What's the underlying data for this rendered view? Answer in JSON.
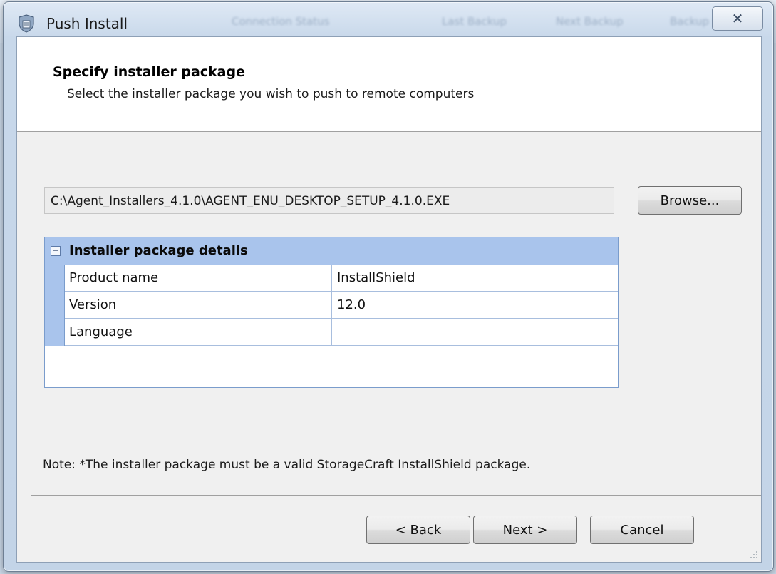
{
  "window": {
    "title": "Push Install",
    "close_glyph": "✕",
    "background_columns": [
      "Connection Status",
      "Last Backup",
      "Next Backup",
      "Backup Status"
    ]
  },
  "header": {
    "title": "Specify installer package",
    "subtitle": "Select the installer package you wish to push to remote computers"
  },
  "package": {
    "path": "C:\\Agent_Installers_4.1.0\\AGENT_ENU_DESKTOP_SETUP_4.1.0.EXE",
    "browse_label": "Browse..."
  },
  "details": {
    "title": "Installer package details",
    "expander_glyph": "−",
    "rows": [
      {
        "name": "Product name",
        "value": "InstallShield"
      },
      {
        "name": "Version",
        "value": "12.0"
      },
      {
        "name": "Language",
        "value": ""
      }
    ]
  },
  "note": "Note:  *The installer package must be a valid StorageCraft InstallShield package.",
  "buttons": {
    "back": "< Back",
    "next": "Next >",
    "cancel": "Cancel"
  },
  "icons": {
    "app": "shield-installer-icon",
    "close": "close-icon",
    "expander": "collapse-icon",
    "grip": "resize-grip-icon"
  },
  "colors": {
    "details_header": "#a9c4ec",
    "details_border": "#7a9ccc",
    "client_bg": "#f0f0f0"
  }
}
